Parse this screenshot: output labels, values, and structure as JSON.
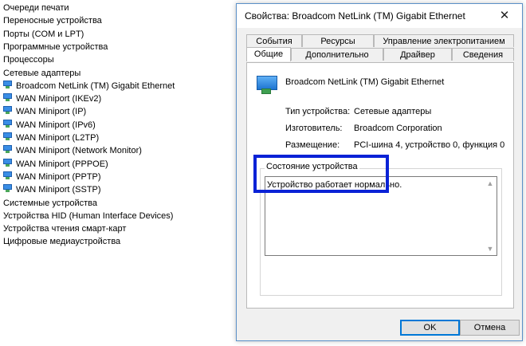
{
  "device_tree": {
    "items": [
      {
        "label": "Очереди печати",
        "child": false
      },
      {
        "label": "Переносные устройства",
        "child": false
      },
      {
        "label": "Порты (COM и LPT)",
        "child": false
      },
      {
        "label": "Программные устройства",
        "child": false
      },
      {
        "label": "Процессоры",
        "child": false
      },
      {
        "label": "Сетевые адаптеры",
        "child": false
      },
      {
        "label": "Broadcom NetLink (TM) Gigabit Ethernet",
        "child": true
      },
      {
        "label": "WAN Miniport (IKEv2)",
        "child": true
      },
      {
        "label": "WAN Miniport (IP)",
        "child": true
      },
      {
        "label": "WAN Miniport (IPv6)",
        "child": true
      },
      {
        "label": "WAN Miniport (L2TP)",
        "child": true
      },
      {
        "label": "WAN Miniport (Network Monitor)",
        "child": true
      },
      {
        "label": "WAN Miniport (PPPOE)",
        "child": true
      },
      {
        "label": "WAN Miniport (PPTP)",
        "child": true
      },
      {
        "label": "WAN Miniport (SSTP)",
        "child": true
      },
      {
        "label": "Системные устройства",
        "child": false
      },
      {
        "label": "Устройства HID (Human Interface Devices)",
        "child": false
      },
      {
        "label": "Устройства чтения смарт-карт",
        "child": false
      },
      {
        "label": "Цифровые медиаустройства",
        "child": false
      }
    ]
  },
  "dialog": {
    "title": "Свойства: Broadcom NetLink (TM) Gigabit Ethernet",
    "close_glyph": "✕",
    "tabs_back": [
      "События",
      "Ресурсы",
      "Управление электропитанием"
    ],
    "tabs_front": [
      "Общие",
      "Дополнительно",
      "Драйвер",
      "Сведения"
    ],
    "active_tab": "Общие",
    "device_name": "Broadcom NetLink (TM) Gigabit Ethernet",
    "props": {
      "type_label": "Тип устройства:",
      "type_value": "Сетевые адаптеры",
      "mfr_label": "Изготовитель:",
      "mfr_value": "Broadcom Corporation",
      "loc_label": "Размещение:",
      "loc_value": "PCI-шина 4, устройство 0, функция 0"
    },
    "status_group_label": "Состояние устройства",
    "status_text": "Устройство работает нормально.",
    "ok_label": "OK",
    "cancel_label": "Отмена"
  },
  "colors": {
    "highlight_border": "#0a22d6",
    "dialog_border": "#5a90c8"
  }
}
